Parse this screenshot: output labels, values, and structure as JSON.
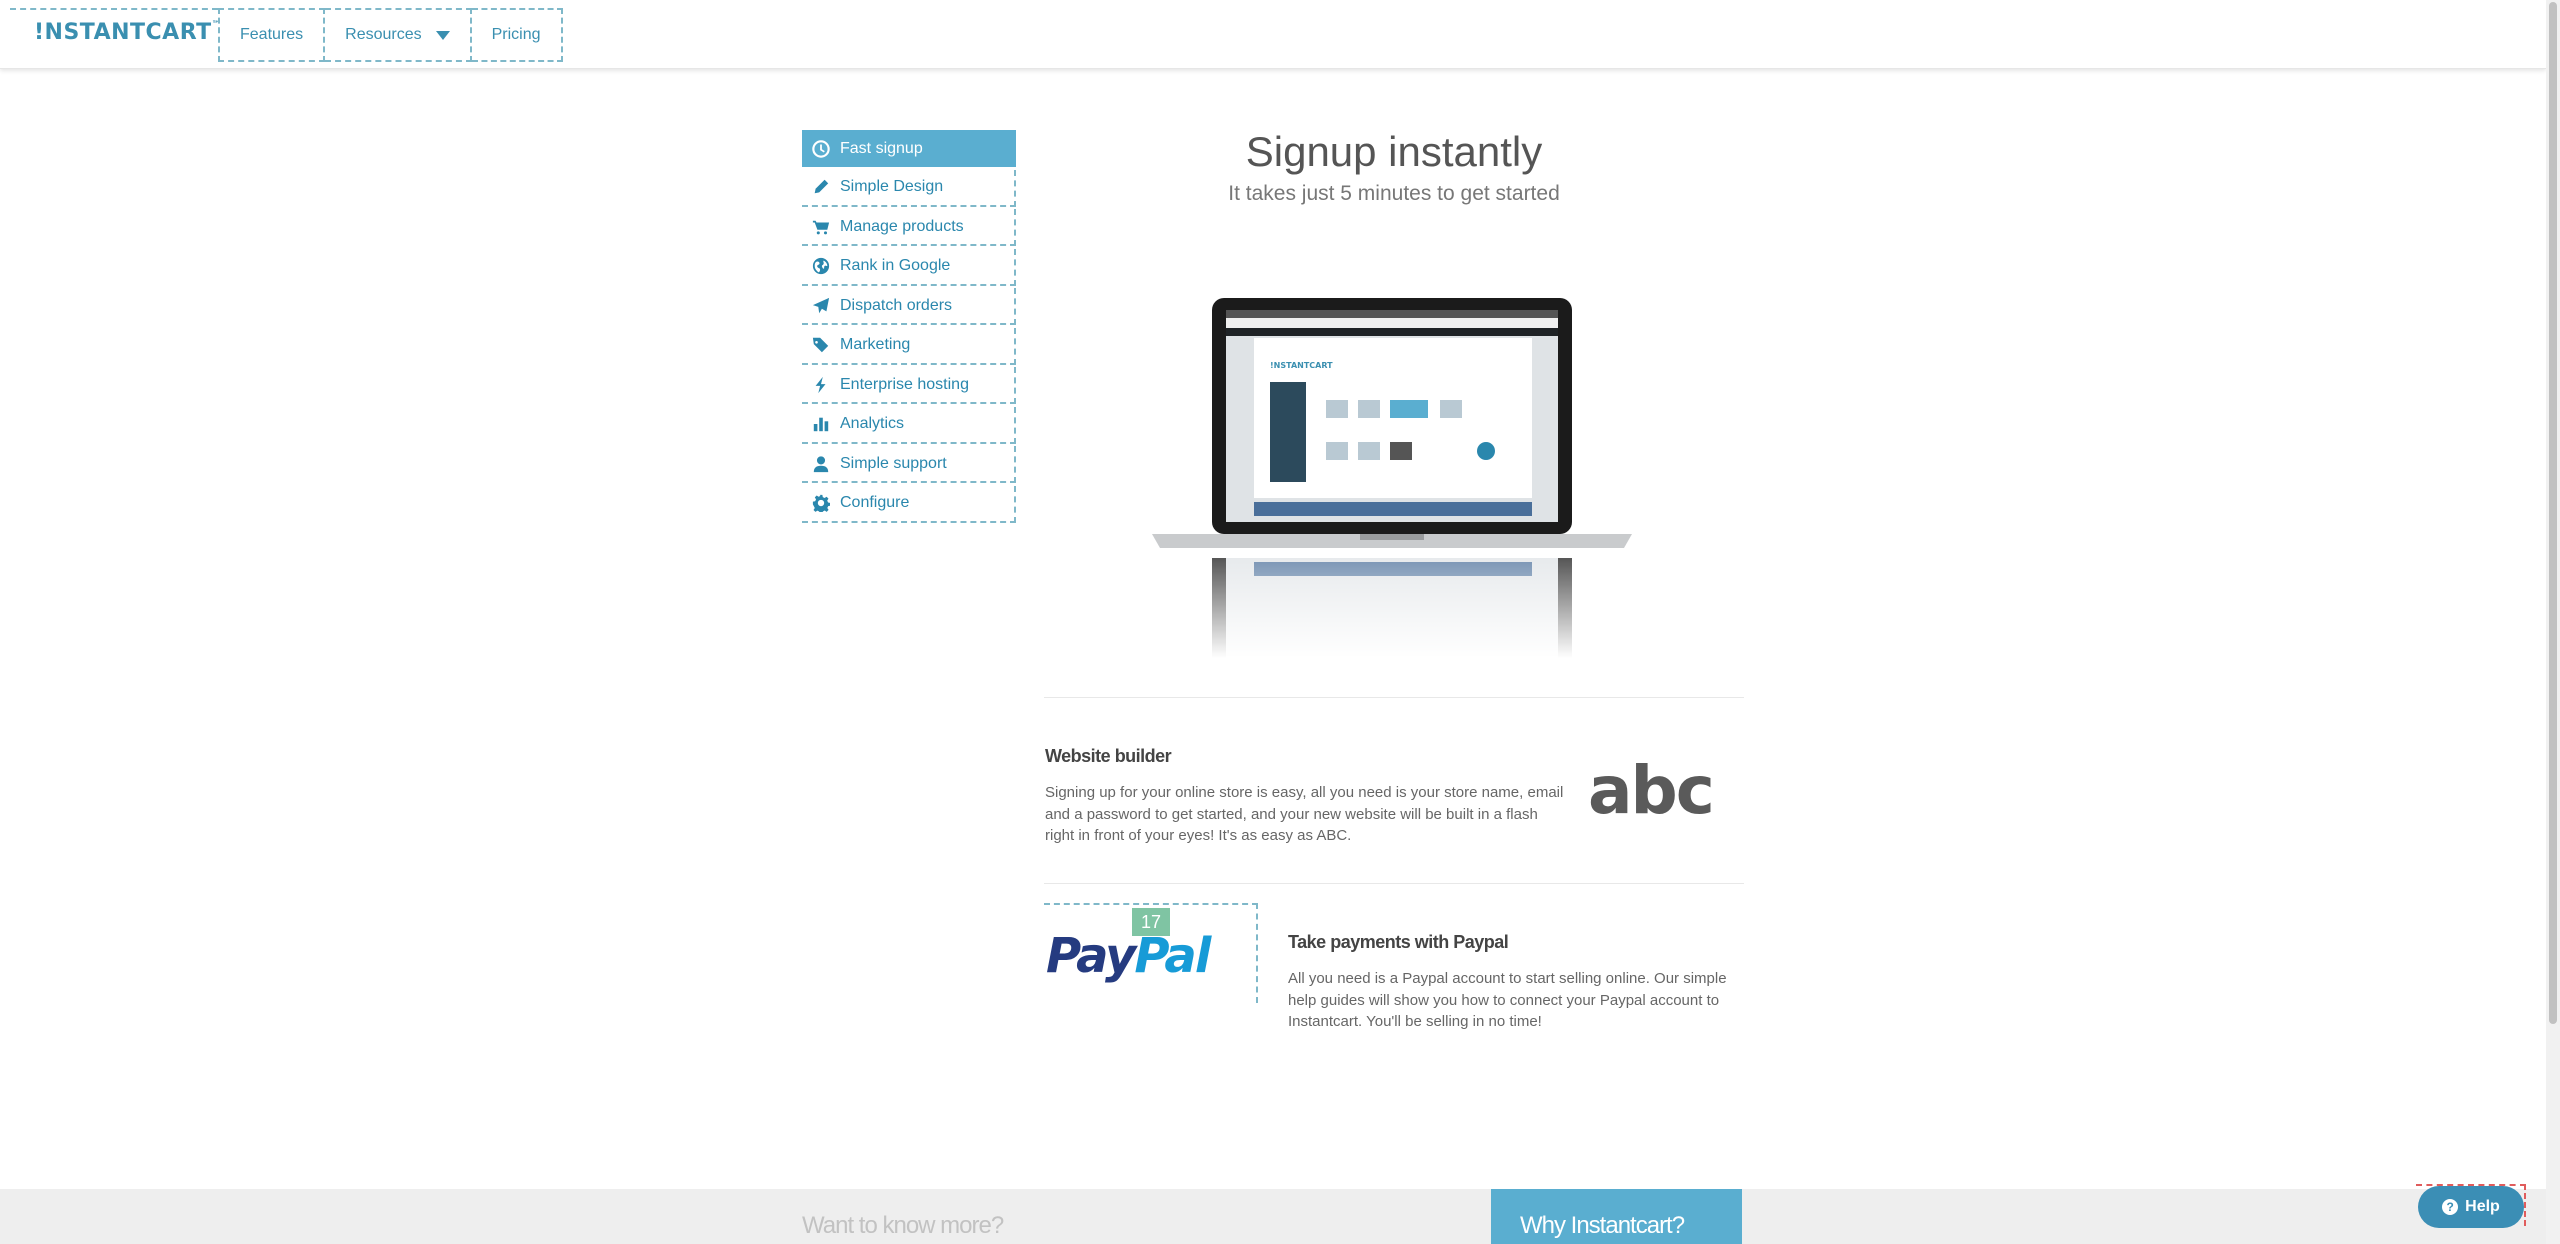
{
  "header": {
    "logo_text": "!NSTANTCART",
    "logo_tm": "™",
    "nav": [
      {
        "label": "Features"
      },
      {
        "label": "Resources"
      },
      {
        "label": "Pricing"
      }
    ]
  },
  "sidemenu": {
    "items": [
      {
        "label": "Fast signup",
        "icon": "clock-icon",
        "active": true
      },
      {
        "label": "Simple Design",
        "icon": "pencil-icon"
      },
      {
        "label": "Manage products",
        "icon": "cart-icon"
      },
      {
        "label": "Rank in Google",
        "icon": "globe-icon"
      },
      {
        "label": "Dispatch orders",
        "icon": "paper-plane-icon"
      },
      {
        "label": "Marketing",
        "icon": "tags-icon"
      },
      {
        "label": "Enterprise hosting",
        "icon": "lightning-icon"
      },
      {
        "label": "Analytics",
        "icon": "bar-chart-icon"
      },
      {
        "label": "Simple support",
        "icon": "user-icon"
      },
      {
        "label": "Configure",
        "icon": "gear-icon"
      }
    ]
  },
  "main": {
    "title": "Signup instantly",
    "subtitle": "It takes just 5 minutes to get started",
    "features": [
      {
        "title": "Website builder",
        "text": "Signing up for your online store is easy, all you need is your store name, email and a password to get started, and your new website will be built in a flash right in front of your eyes! It's as easy as ABC.",
        "art": "abc"
      },
      {
        "title": "Take payments with Paypal",
        "text": "All you need is a Paypal account to start selling online. Our simple help guides will show you how to connect your Paypal account to Instantcart. You'll be selling in no time!",
        "logo_pay": "Pay",
        "logo_pal": "Pal",
        "badge": "17"
      }
    ]
  },
  "footer": {
    "left": "Want to know more?",
    "right": "Why Instantcart?"
  },
  "help": {
    "label": "Help",
    "icon_glyph": "?"
  },
  "colors": {
    "accent": "#5aaed0",
    "link": "#2a87ad",
    "text": "#555555"
  }
}
